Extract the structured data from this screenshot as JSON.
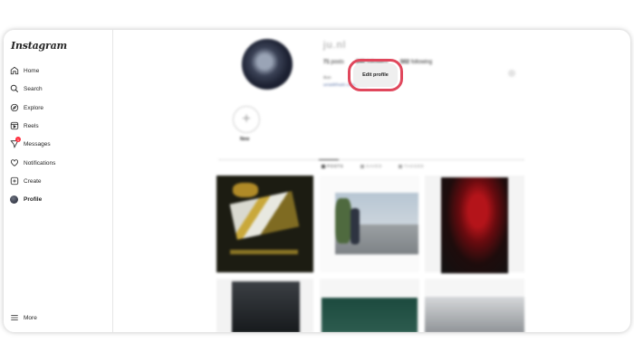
{
  "app": {
    "logo": "Instagram"
  },
  "sidebar": {
    "items": [
      {
        "label": "Home",
        "icon": "home-icon"
      },
      {
        "label": "Search",
        "icon": "search-icon"
      },
      {
        "label": "Explore",
        "icon": "compass-icon"
      },
      {
        "label": "Reels",
        "icon": "reels-icon"
      },
      {
        "label": "Messages",
        "icon": "messenger-icon",
        "badge": "1"
      },
      {
        "label": "Notifications",
        "icon": "heart-icon"
      },
      {
        "label": "Create",
        "icon": "plus-square-icon"
      },
      {
        "label": "Profile",
        "icon": "avatar-icon",
        "active": true
      }
    ],
    "more_label": "More"
  },
  "profile": {
    "username": "ju.nl",
    "edit_button": "Edit profile",
    "stats": {
      "posts": "71",
      "posts_label": "posts",
      "followers": "643",
      "followers_label": "followers",
      "following": "502",
      "following_label": "following"
    },
    "bio_name": "Ikon",
    "bio_link": "uniatkfnatt.com/unsia"
  },
  "highlights": {
    "new_label": "New"
  },
  "tabs": [
    {
      "label": "POSTS",
      "active": true
    },
    {
      "label": "SAVED",
      "active": false
    },
    {
      "label": "TAGGED",
      "active": false
    }
  ],
  "colors": {
    "highlight_ring": "#e0475c",
    "badge": "#ff3040"
  }
}
